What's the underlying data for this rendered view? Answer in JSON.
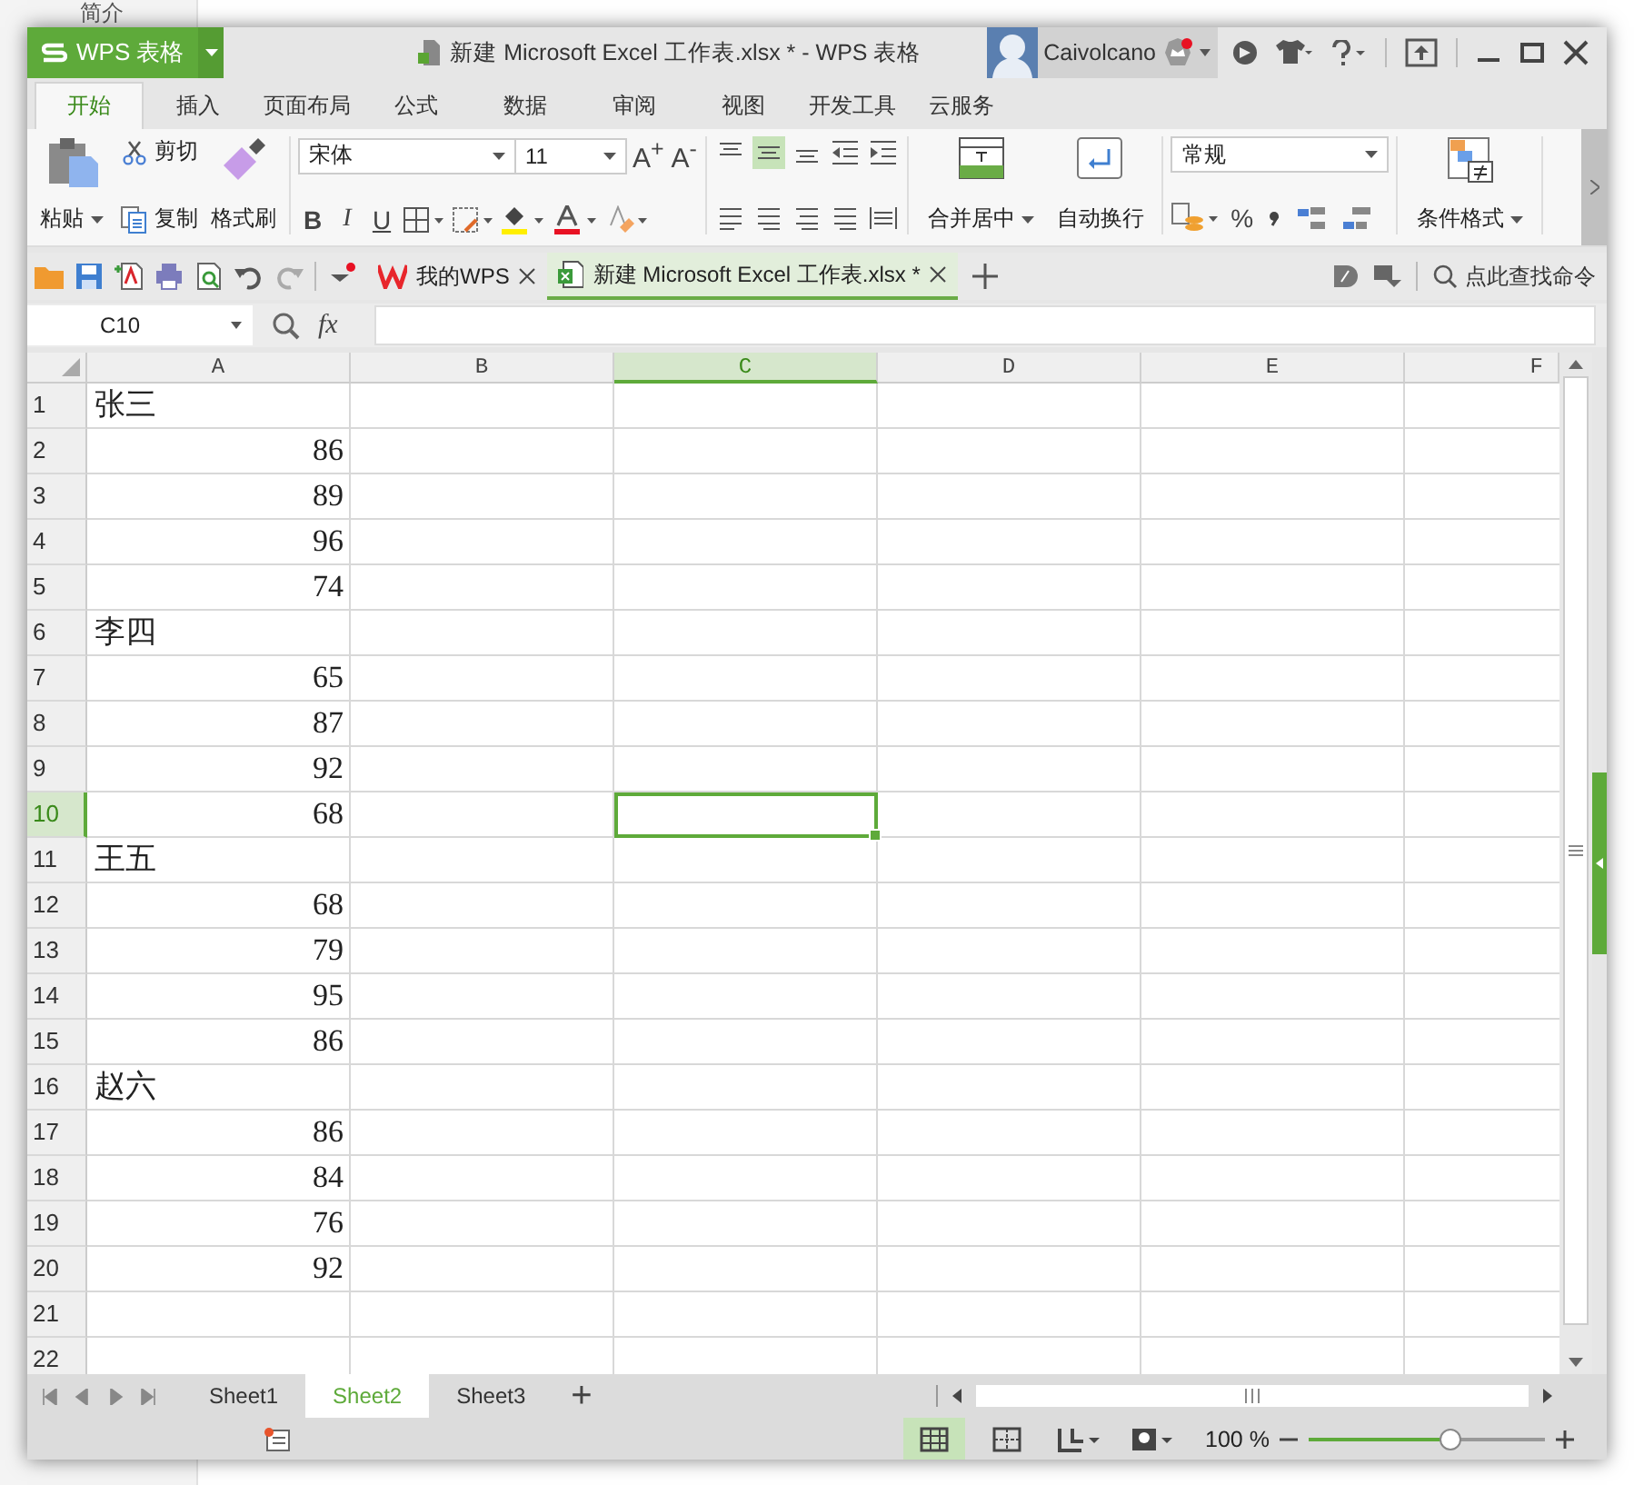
{
  "background_page": {
    "sidebar_item": "简介"
  },
  "app_button": {
    "label": "WPS 表格"
  },
  "window": {
    "title": "新建 Microsoft Excel 工作表.xlsx * - WPS 表格"
  },
  "user": {
    "name": "Caivolcano",
    "notification": true
  },
  "ribbon_tabs": [
    {
      "label": "开始",
      "selected": true
    },
    {
      "label": "插入",
      "selected": false
    },
    {
      "label": "页面布局",
      "selected": false
    },
    {
      "label": "公式",
      "selected": false
    },
    {
      "label": "数据",
      "selected": false
    },
    {
      "label": "审阅",
      "selected": false
    },
    {
      "label": "视图",
      "selected": false
    },
    {
      "label": "开发工具",
      "selected": false
    },
    {
      "label": "云服务",
      "selected": false
    }
  ],
  "ribbon": {
    "paste": "粘贴",
    "cut": "剪切",
    "copy": "复制",
    "format_painter": "格式刷",
    "font_name": "宋体",
    "font_size": "11",
    "grow_font": "A$^{+}$",
    "shrink_font": "A$^{-}$",
    "bold": "B",
    "italic": "I",
    "underline": "U",
    "merge_center": "合并居中",
    "wrap_text": "自动换行",
    "number_format": "常规",
    "percent": "%",
    "conditional_format": "条件格式"
  },
  "doc_tabs": [
    {
      "label": "我的WPS",
      "selected": false
    },
    {
      "label": "新建 Microsoft Excel 工作表.xlsx *",
      "selected": true
    }
  ],
  "command_search": {
    "placeholder": "点此查找命令"
  },
  "formula_bar": {
    "name_box": "C10",
    "fx": "fx",
    "value_present": false
  },
  "columns": [
    {
      "label": "A",
      "selected": false
    },
    {
      "label": "B",
      "selected": false
    },
    {
      "label": "C",
      "selected": true
    },
    {
      "label": "D",
      "selected": false
    },
    {
      "label": "E",
      "selected": false
    },
    {
      "label": "F",
      "selected": false
    }
  ],
  "rows": [
    {
      "label": "1",
      "selected": false,
      "value": "张三",
      "kind": "text"
    },
    {
      "label": "2",
      "selected": false,
      "value": "86",
      "kind": "number"
    },
    {
      "label": "3",
      "selected": false,
      "value": "89",
      "kind": "number"
    },
    {
      "label": "4",
      "selected": false,
      "value": "96",
      "kind": "number"
    },
    {
      "label": "5",
      "selected": false,
      "value": "74",
      "kind": "number"
    },
    {
      "label": "6",
      "selected": false,
      "value": "李四",
      "kind": "text"
    },
    {
      "label": "7",
      "selected": false,
      "value": "65",
      "kind": "number"
    },
    {
      "label": "8",
      "selected": false,
      "value": "87",
      "kind": "number"
    },
    {
      "label": "9",
      "selected": false,
      "value": "92",
      "kind": "number"
    },
    {
      "label": "10",
      "selected": true,
      "value": "68",
      "kind": "number"
    },
    {
      "label": "11",
      "selected": false,
      "value": "王五",
      "kind": "text"
    },
    {
      "label": "12",
      "selected": false,
      "value": "68",
      "kind": "number"
    },
    {
      "label": "13",
      "selected": false,
      "value": "79",
      "kind": "number"
    },
    {
      "label": "14",
      "selected": false,
      "value": "95",
      "kind": "number"
    },
    {
      "label": "15",
      "selected": false,
      "value": "86",
      "kind": "number"
    },
    {
      "label": "16",
      "selected": false,
      "value": "赵六",
      "kind": "text"
    },
    {
      "label": "17",
      "selected": false,
      "value": "86",
      "kind": "number"
    },
    {
      "label": "18",
      "selected": false,
      "value": "84",
      "kind": "number"
    },
    {
      "label": "19",
      "selected": false,
      "value": "76",
      "kind": "number"
    },
    {
      "label": "20",
      "selected": false,
      "value": "92",
      "kind": "number"
    },
    {
      "label": "21",
      "selected": false
    },
    {
      "label": "22",
      "selected": false
    }
  ],
  "sheet_tabs": [
    {
      "label": "Sheet1",
      "selected": false
    },
    {
      "label": "Sheet2",
      "selected": true
    },
    {
      "label": "Sheet3",
      "selected": false
    }
  ],
  "add_sheet": "+",
  "status_bar": {
    "zoom": "100 %",
    "zoom_slider": {
      "level": 0.6
    }
  }
}
